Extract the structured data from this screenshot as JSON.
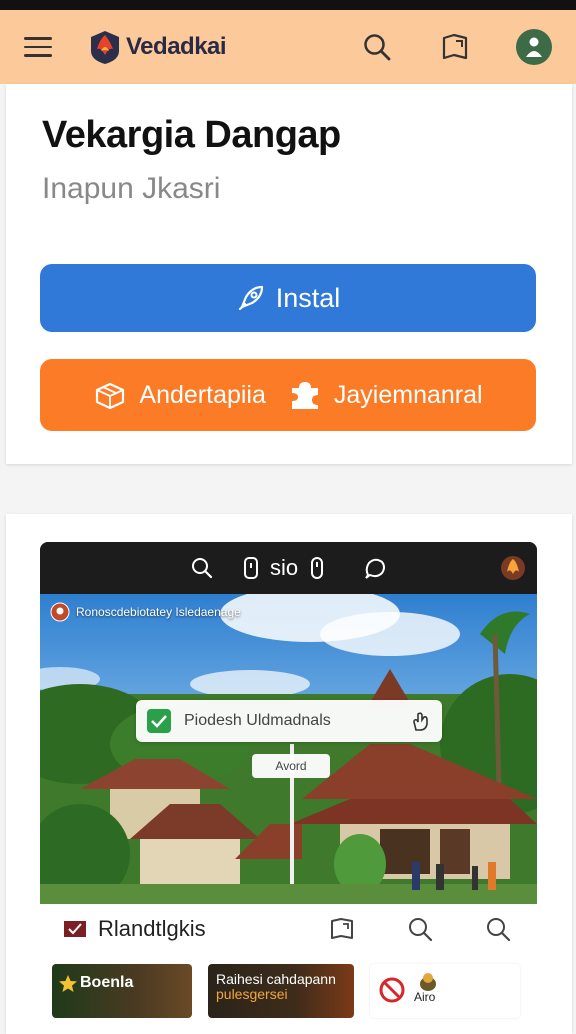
{
  "appbar": {
    "brand": "Vedadkai",
    "search_icon": "search-icon",
    "book_icon": "book-icon",
    "avatar_icon": "user-avatar-icon",
    "background": "#fcc99a"
  },
  "hero": {
    "title": "Vekargia Dangap",
    "subtitle": "Inapun Jkasri",
    "install_label": "Instal",
    "orange_left_label": "Andertapiia",
    "orange_right_label": "Jayiemnanral",
    "install_color": "#3179d8",
    "orange_color": "#fb7b26"
  },
  "preview": {
    "toolbar_text": "sio",
    "caption": "Ronoscdebiotatey Isledaenage",
    "pill_text": "Piodesh Uldmadnals",
    "chip_text": "Avord"
  },
  "tabbar": {
    "label": "Rlandtlgkis"
  },
  "tiles": [
    {
      "text": "Boenla"
    },
    {
      "text_line1": "Raihesi cahdapann",
      "text_line2": "pulesgersei"
    },
    {
      "text": "Airo"
    }
  ]
}
